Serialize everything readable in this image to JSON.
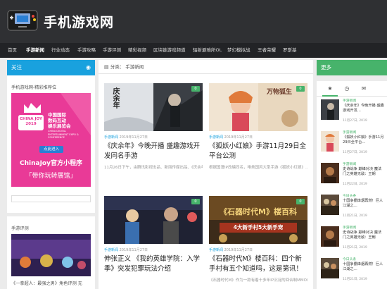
{
  "site": {
    "logo_text": "手机游戏网"
  },
  "nav": [
    {
      "label": "首页"
    },
    {
      "label": "手游新闻"
    },
    {
      "label": "行业动态"
    },
    {
      "label": "手游攻略"
    },
    {
      "label": "手游评测"
    },
    {
      "label": "精彩视频"
    },
    {
      "label": "区块链游戏频道"
    },
    {
      "label": "辐射避难所OL"
    },
    {
      "label": "梦幻模拟战"
    },
    {
      "label": "王者荣耀"
    },
    {
      "label": "罗斯基"
    }
  ],
  "left": {
    "focus_title": "关注",
    "focus_icon": "rss",
    "recommend_label": "手机游戏网-精彩推荐位",
    "promo": {
      "cn_line1": "中国国际",
      "cn_line2": "数码互动",
      "cn_line3": "娱乐展览会",
      "logo_text": "CHINA JOY",
      "year": "2019",
      "en_text": "CHINA DIGITAL ENTERTAINMENT EXPO & CONFERENCE",
      "button": "点此进入",
      "title": "ChinaJoy官方小程序",
      "subtitle": "「带你玩转展馆」"
    },
    "section_label": "手游评测",
    "bottom_caption": "《一拳超人：最强之男》角色评测 无"
  },
  "main": {
    "breadcrumb_prefix": "分类：",
    "breadcrumb_value": "手游新闻",
    "cards": [
      {
        "cat": "手游新闻",
        "date": "2019年11月27日",
        "title": "《庆余年》今晚开播 盛趣游戏开发同名手游",
        "excerpt": "11月26日下午，由腾讯影视出品、新丽传媒出品、《庆余年》…",
        "badge": "0",
        "thumb_text": "庆余年"
      },
      {
        "cat": "手游新闻",
        "date": "2019年11月27日",
        "title": "《狐妖小红娘》手游11月29日全平台公测",
        "excerpt": "根据国漫IP改编同名，唯美国风大型手游《狐妖小红娘》…",
        "badge": "0",
        "thumb_text": "万物狐生"
      },
      {
        "cat": "手游新闻",
        "date": "2019年11月27日",
        "title": "伸张正义 《我的英雄学院：入学季》突发犯罪玩法介绍",
        "excerpt": "《我的英雄学院：入学季》手游中，除了…",
        "badge": "0",
        "thumb_text": ""
      },
      {
        "cat": "手游新闻",
        "date": "2019年11月27日",
        "title": "《石器时代M》楼百科：四个新手村有五个知道吗，这是第讯！",
        "excerpt": "《石器时代M》作为一款有着十多年IP沉淀的回合制MMORPG…",
        "badge": "0",
        "thumb_text": "《石器时代M》楼百科",
        "thumb_sub": "4大新手村5大新手宠"
      }
    ]
  },
  "right": {
    "head": "更多",
    "tabs": [
      "★",
      "◷",
      "✉"
    ],
    "items": [
      {
        "cat": "手游新闻",
        "title": "《庆余年》今晚开播 盛趣游戏开发…",
        "date": "11月27日, 2019"
      },
      {
        "cat": "手游新闻",
        "title": "《狐妖小红娘》手游11月29日全平台…",
        "date": "11月27日, 2019"
      },
      {
        "cat": "手游新闻",
        "title": "史诗战争 巅峰对决 魔法门之英雄无敌：王朝 ",
        "date": "11月22日, 2019"
      },
      {
        "cat": "今日头条",
        "title": "十国争霸烽烟再燃！巨人江湖之…",
        "date": "11月21日, 2019"
      },
      {
        "cat": "手游新闻",
        "title": "史诗战争 巅峰对决 魔法门之英雄无敌：王朝",
        "date": "11月21日, 2019"
      },
      {
        "cat": "今日头条",
        "title": "十国争霸烽烟再燃！巨人江湖之…",
        "date": "11月21日, 2019"
      }
    ]
  }
}
